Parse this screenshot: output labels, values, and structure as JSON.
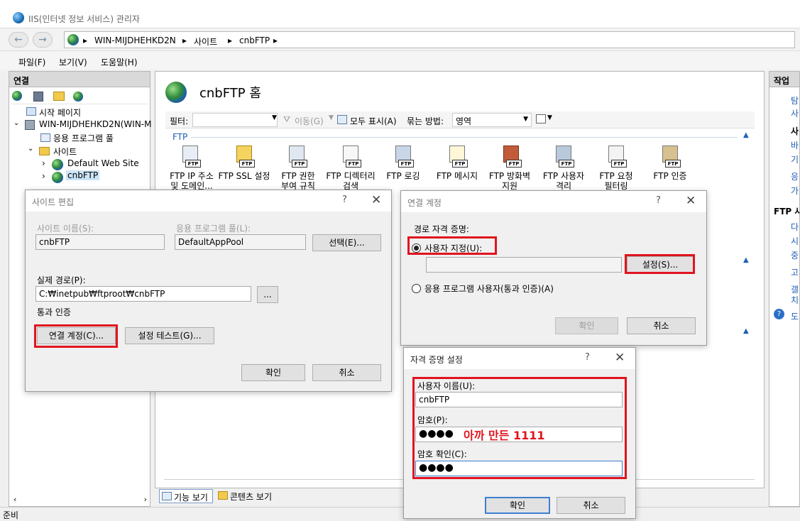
{
  "window": {
    "title": "IIS(인터넷 정보 서비스) 관리자"
  },
  "address": {
    "crumbs": [
      "WIN-MIJDHEHKD2N",
      "사이트",
      "cnbFTP"
    ]
  },
  "menu": {
    "file": "파일(F)",
    "view": "보기(V)",
    "help": "도움말(H)"
  },
  "connections": {
    "header": "연결",
    "tree": {
      "start_page": "시작 페이지",
      "server": "WIN-MIJDHEHKD2N(WIN-M",
      "app_pools": "응용 프로그램 풀",
      "sites": "사이트",
      "default_site": "Default Web Site",
      "cnbftp": "cnbFTP"
    }
  },
  "home": {
    "title": "cnbFTP 홈",
    "filter_label": "필터:",
    "go_label": "이동(G)",
    "show_all": "모두 표시(A)",
    "group_label": "묶는 방법:",
    "group_value": "영역",
    "section": "FTP",
    "features": [
      {
        "line1": "FTP IP 주소",
        "line2": "및 도메인..."
      },
      {
        "line1": "FTP SSL 설정",
        "line2": ""
      },
      {
        "line1": "FTP 권한",
        "line2": "부여 규칙"
      },
      {
        "line1": "FTP 디렉터리",
        "line2": "검색"
      },
      {
        "line1": "FTP 로깅",
        "line2": ""
      },
      {
        "line1": "FTP 메시지",
        "line2": ""
      },
      {
        "line1": "FTP 방화벽",
        "line2": "지원"
      },
      {
        "line1": "FTP 사용자",
        "line2": "격리"
      },
      {
        "line1": "FTP 요청",
        "line2": "필터링"
      },
      {
        "line1": "FTP 인증",
        "line2": ""
      }
    ],
    "features_view": "기능 보기",
    "content_view": "콘텐츠 보기"
  },
  "actions": {
    "header": "작업",
    "frag": [
      "탐",
      "사",
      "사",
      "바",
      "기",
      "응",
      "가",
      "FTP 사",
      "다",
      "시",
      "중",
      "고",
      "갤",
      "치",
      "도"
    ]
  },
  "status": {
    "text": "준비"
  },
  "edit_site": {
    "title": "사이트 편집",
    "help": "?",
    "site_name_label": "사이트 이름(S):",
    "site_name_value": "cnbFTP",
    "app_pool_label": "응용 프로그램 풀(L):",
    "app_pool_value": "DefaultAppPool",
    "select_button": "선택(E)...",
    "physical_path_label": "실제 경로(P):",
    "physical_path_value": "C:₩inetpub₩ftproot₩cnbFTP",
    "browse_button": "...",
    "pass_through_label": "통과 인증",
    "connect_as_button": "연결 계정(C)...",
    "test_settings_button": "설정 테스트(G)...",
    "ok_button": "확인",
    "cancel_button": "취소"
  },
  "connect_as": {
    "title": "연결 계정",
    "help": "?",
    "path_credentials_label": "경로 자격 증명:",
    "specific_user_label": "사용자 지정(U):",
    "set_button": "설정(S)...",
    "app_user_label": "응용 프로그램 사용자(통과 인증)(A)",
    "ok_button": "확인",
    "cancel_button": "취소"
  },
  "set_credentials": {
    "title": "자격 증명 설정",
    "help": "?",
    "username_label": "사용자 이름(U):",
    "username_value": "cnbFTP",
    "password_label": "암호(P):",
    "password_value": "●●●●",
    "confirm_label": "암호 확인(C):",
    "confirm_value": "●●●●",
    "annotation": "아까 만든 1111",
    "ok_button": "확인",
    "cancel_button": "취소"
  },
  "colors": {
    "highlight": "#e0141e",
    "annotation": "#e0141e"
  }
}
